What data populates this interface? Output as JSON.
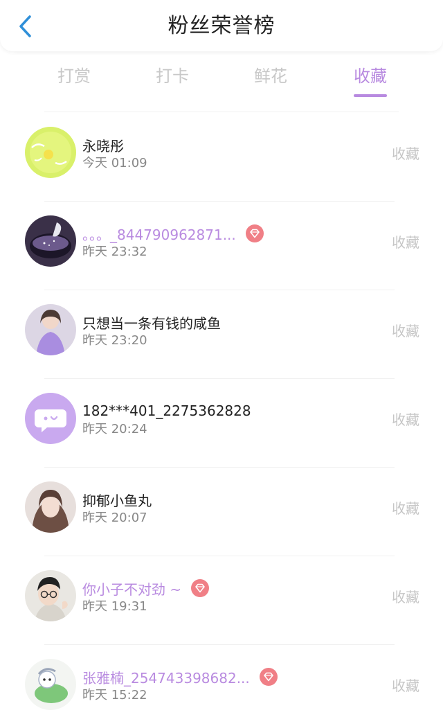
{
  "header": {
    "title": "粉丝荣誉榜",
    "back_icon": "chevron-left-icon"
  },
  "tabs": [
    {
      "label": "打赏",
      "active": false
    },
    {
      "label": "打卡",
      "active": false
    },
    {
      "label": "鲜花",
      "active": false
    },
    {
      "label": "收藏",
      "active": true
    }
  ],
  "colors": {
    "accent": "#b88ae0",
    "back": "#2f8fd8",
    "badge": "#f07f86",
    "muted": "#c6c6c6"
  },
  "fans": [
    {
      "name": "永晓彤",
      "time": "今天 01:09",
      "action": "收藏",
      "vip": false,
      "avatar": "lime-circle-avatar"
    },
    {
      "name": "。。。_844790962871...",
      "time": "昨天 23:32",
      "action": "收藏",
      "vip": true,
      "avatar": "galaxy-bowl-avatar"
    },
    {
      "name": "只想当一条有钱的咸鱼",
      "time": "昨天 23:20",
      "action": "收藏",
      "vip": false,
      "avatar": "girl-purple-avatar"
    },
    {
      "name": "182***401_2275362828",
      "time": "昨天 20:24",
      "action": "收藏",
      "vip": false,
      "avatar": "default-chat-avatar"
    },
    {
      "name": "抑郁小鱼丸",
      "time": "昨天 20:07",
      "action": "收藏",
      "vip": false,
      "avatar": "girl-portrait-avatar"
    },
    {
      "name": "你小子不对劲 ~",
      "time": "昨天 19:31",
      "action": "收藏",
      "vip": true,
      "avatar": "boy-glasses-avatar"
    },
    {
      "name": "张雅楠_254743398682...",
      "time": "昨天 15:22",
      "action": "收藏",
      "vip": true,
      "avatar": "cartoon-green-avatar"
    }
  ]
}
